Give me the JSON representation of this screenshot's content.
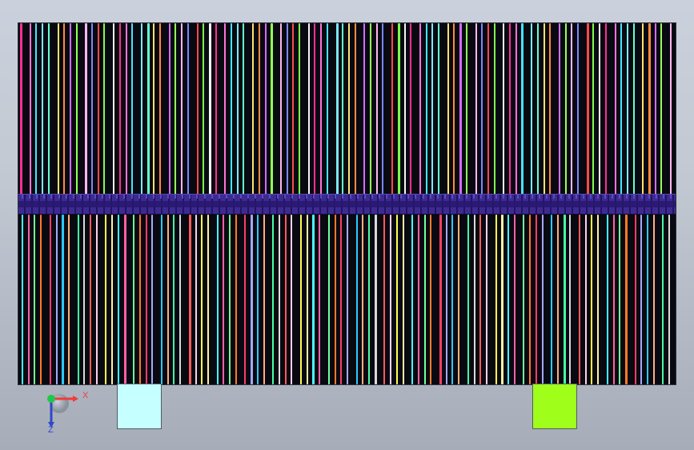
{
  "window": {
    "title": ""
  },
  "viewport": {
    "background_top": "#cbd1dc",
    "background_bottom": "#a6adb9",
    "accent": "#3d2a91"
  },
  "axis": {
    "x_label": "X",
    "z_label": "Z",
    "x_color": "#f23b3b",
    "y_color": "#1ec84a",
    "z_color": "#2f47c8"
  },
  "upper_palette": [
    "#ff2f92",
    "#ff73d8",
    "#46e4ff",
    "#7be9ff",
    "#66ffd1",
    "#ffe36e",
    "#ff8d3a",
    "#d46dff",
    "#96ff57",
    "#ffb6f2",
    "#7a88ff",
    "#ff4b4b",
    "#7fff4a",
    "#f5f5f5"
  ],
  "lower_palette": [
    "#ffd1ea",
    "#ffff4e",
    "#fff4a1",
    "#46ffff",
    "#ff61a6",
    "#73ff9b",
    "#ff7a28",
    "#ff3d67",
    "#a6a8ff",
    "#2cc9ff",
    "#ffaf7a",
    "#48ffa4",
    "#d9d9d9",
    "#ff5a5a"
  ],
  "feet": [
    {
      "color": "#c5ffff"
    },
    {
      "color": "#9fff1a"
    }
  ]
}
